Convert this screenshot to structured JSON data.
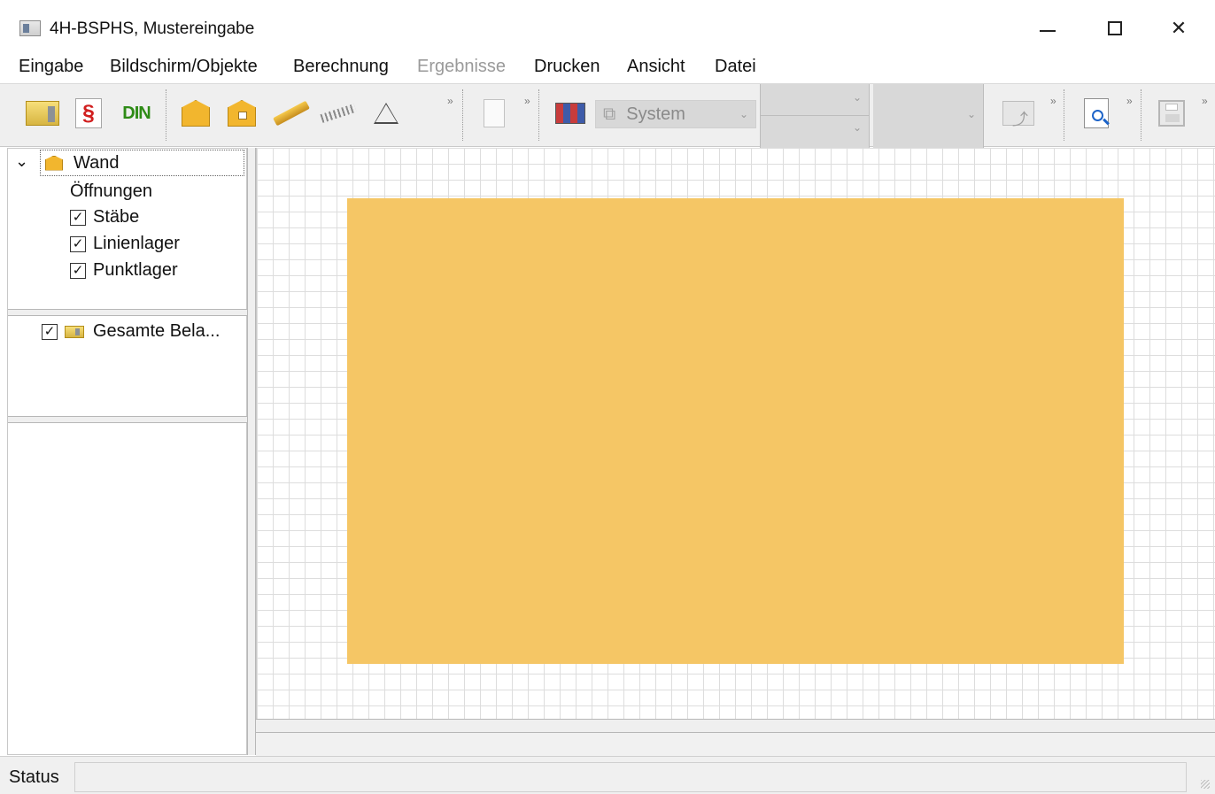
{
  "window": {
    "title": "4H-BSPHS, Mustereingabe"
  },
  "menu": {
    "items": [
      "Eingabe",
      "Bildschirm/Objekte",
      "Berechnung",
      "Ergebnisse",
      "Drucken",
      "Ansicht",
      "Datei"
    ]
  },
  "toolbar": {
    "din_label": "DIN",
    "section_label": "§",
    "system_label": "System",
    "chevron": "»"
  },
  "tree": {
    "root": "Wand",
    "children": [
      "Öffnungen",
      "Stäbe",
      "Linienlager",
      "Punktlager"
    ],
    "load_item": "Gesamte Bela..."
  },
  "status": {
    "label": "Status"
  },
  "colors": {
    "wall": "#f5c562",
    "grid": "#dddddd",
    "toolbar": "#efefef"
  },
  "icons": [
    "folder-icon",
    "section-icon",
    "din-icon",
    "wall-icon",
    "opening-icon",
    "beam-icon",
    "ruler-icon",
    "support-icon",
    "layers-icon",
    "display-icon",
    "arrow-icon",
    "print-preview-icon",
    "save-icon"
  ]
}
